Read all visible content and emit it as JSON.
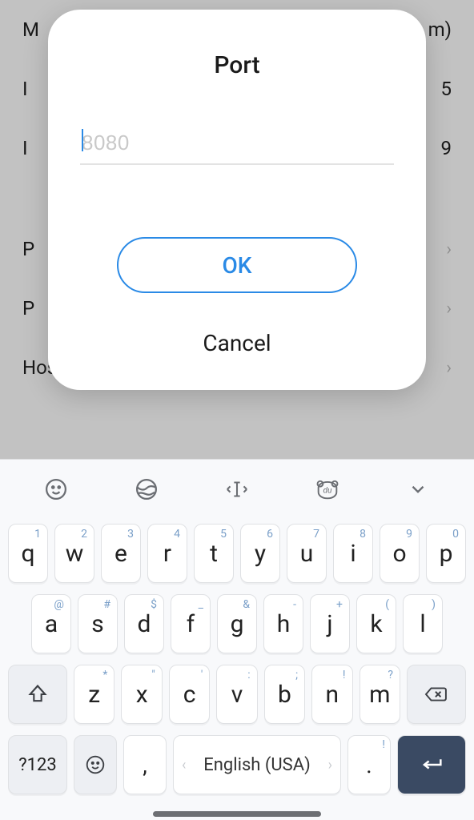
{
  "background": {
    "items": [
      {
        "label": "M",
        "value": "m)"
      },
      {
        "label": "I",
        "value": "5"
      },
      {
        "label": "I",
        "value": "9"
      },
      {
        "label": "P",
        "value": "›"
      },
      {
        "label": "P",
        "value": "›"
      },
      {
        "label": "Hostname",
        "value": "›"
      }
    ]
  },
  "dialog": {
    "title": "Port",
    "placeholder": "8080",
    "value": "",
    "ok_label": "OK",
    "cancel_label": "Cancel"
  },
  "toolbar": {
    "icons": [
      "smiley-icon",
      "globe-icon",
      "text-cursor-icon",
      "bear-du-icon",
      "chevron-down-icon"
    ]
  },
  "keyboard": {
    "rows": [
      [
        {
          "main": "q",
          "sup": "1"
        },
        {
          "main": "w",
          "sup": "2"
        },
        {
          "main": "e",
          "sup": "3"
        },
        {
          "main": "r",
          "sup": "4"
        },
        {
          "main": "t",
          "sup": "5"
        },
        {
          "main": "y",
          "sup": "6"
        },
        {
          "main": "u",
          "sup": "7"
        },
        {
          "main": "i",
          "sup": "8"
        },
        {
          "main": "o",
          "sup": "9"
        },
        {
          "main": "p",
          "sup": "0"
        }
      ],
      [
        {
          "main": "a",
          "sup": "@"
        },
        {
          "main": "s",
          "sup": "#"
        },
        {
          "main": "d",
          "sup": "$"
        },
        {
          "main": "f",
          "sup": "_"
        },
        {
          "main": "g",
          "sup": "&"
        },
        {
          "main": "h",
          "sup": "-"
        },
        {
          "main": "j",
          "sup": "+"
        },
        {
          "main": "k",
          "sup": "("
        },
        {
          "main": "l",
          "sup": ")"
        }
      ],
      [
        {
          "main": "z",
          "sup": "*"
        },
        {
          "main": "x",
          "sup": "\""
        },
        {
          "main": "c",
          "sup": "'"
        },
        {
          "main": "v",
          "sup": ":"
        },
        {
          "main": "b",
          "sup": ";"
        },
        {
          "main": "n",
          "sup": "!"
        },
        {
          "main": "m",
          "sup": "?"
        }
      ]
    ],
    "num_toggle": "?123",
    "comma": ",",
    "space_label": "English (USA)",
    "period": ".",
    "period_sup": "!"
  },
  "colors": {
    "accent": "#2a8ae6",
    "enter_bg": "#3a4a63"
  }
}
